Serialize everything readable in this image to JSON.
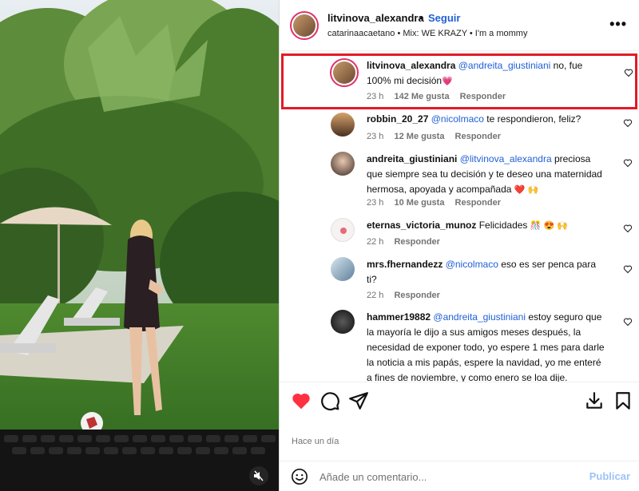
{
  "post": {
    "author": "litvinova_alexandra",
    "dot": "•",
    "follow_label": "Seguir",
    "subtitle": "catarinaacaetano • Mix: WE KRAZY • I'm a mommy",
    "more_label": "•••"
  },
  "comments": [
    {
      "user": "litvinova_alexandra",
      "mention": "@andreita_giustiniani",
      "text": " no, fue 100% mi decisión",
      "emoji": "💗",
      "time": "23 h",
      "likes": "142 Me gusta",
      "reply": "Responder",
      "highlighted": true
    },
    {
      "user": "robbin_20_27",
      "mention": "@nicolmaco",
      "text": " te respondieron, feliz?",
      "emoji": "",
      "time": "23 h",
      "likes": "12 Me gusta",
      "reply": "Responder"
    },
    {
      "user": "andreita_giustiniani",
      "mention": "@litvinova_alexandra",
      "text": " preciosa que siempre sea tu decisión y te deseo una maternidad hermosa, apoyada y acompañada",
      "emoji": "❤️ 🙌",
      "time": "23 h",
      "likes": "10 Me gusta",
      "reply": "Responder"
    },
    {
      "user": "eternas_victoria_munoz",
      "mention": "",
      "text": " Felicidades",
      "emoji": "🎊 😍 🙌",
      "time": "22 h",
      "likes": "",
      "reply": "Responder"
    },
    {
      "user": "mrs.fhernandezz",
      "mention": "@nicolmaco",
      "text": " eso es ser penca para ti?",
      "emoji": "",
      "time": "22 h",
      "likes": "",
      "reply": "Responder"
    },
    {
      "user": "hammer19882",
      "mention": "@andreita_giustiniani",
      "text": " estoy seguro que la mayoría le dijo a sus amigos meses después, la necesidad de exponer todo, yo espere 1 mes para darle la noticia a mis papás, espere la navidad, yo me enteré a fines de noviembre, y como enero se loa dije.",
      "emoji": "",
      "time": "",
      "likes": "",
      "reply": ""
    }
  ],
  "footer": {
    "timestamp": "Hace un día",
    "comment_placeholder": "Añade un comentario...",
    "publish_label": "Publicar"
  },
  "icons": {
    "like": "heart-filled-icon",
    "comment": "comment-bubble-icon",
    "share": "paper-plane-icon",
    "download": "download-icon",
    "save": "bookmark-icon",
    "emoji": "emoji-smiley-icon",
    "mute": "speaker-muted-icon"
  },
  "colors": {
    "like": "#ff3040",
    "link": "#1f5fd6",
    "highlight": "#e21b25",
    "publish": "#9dc3f8"
  }
}
